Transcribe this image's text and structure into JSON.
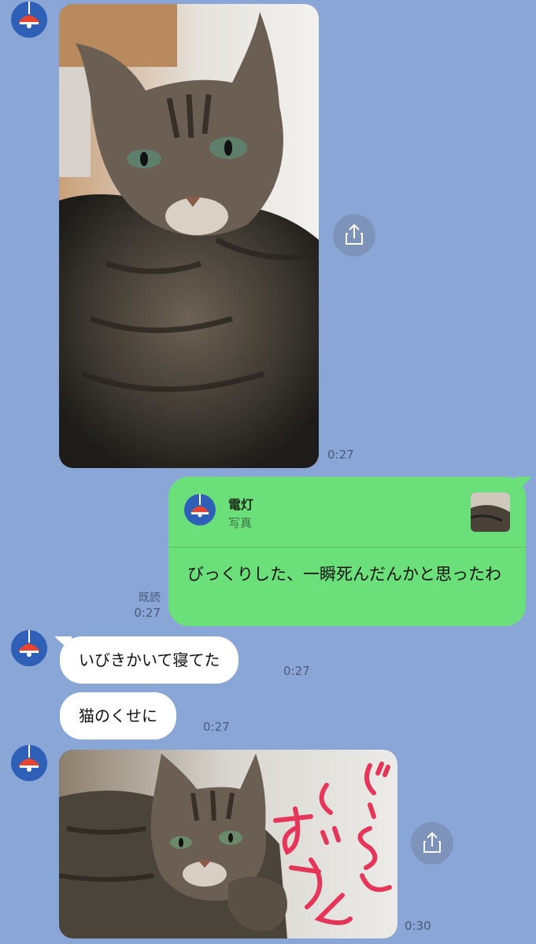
{
  "messages": {
    "photo1_time": "0:27",
    "reply": {
      "quote_name": "電灯",
      "quote_sub": "写真",
      "text": "びっくりした、一瞬死んだんかと思ったわ",
      "read_label": "既読",
      "time": "0:27"
    },
    "text1": {
      "text": "いびきかいて寝てた",
      "time": "0:27"
    },
    "text2": {
      "text": "猫のくせに",
      "time": "0:27"
    },
    "photo2": {
      "caption": "ぐーぱんすっぞ",
      "time": "0:30"
    }
  },
  "colors": {
    "background": "#8aa6d6",
    "sent_bubble": "#6be07a",
    "received_bubble": "#ffffff",
    "avatar_bg": "#2f60b8",
    "lamp_red": "#e8432e"
  },
  "icons": {
    "avatar": "lamp-icon",
    "share": "share-icon"
  }
}
